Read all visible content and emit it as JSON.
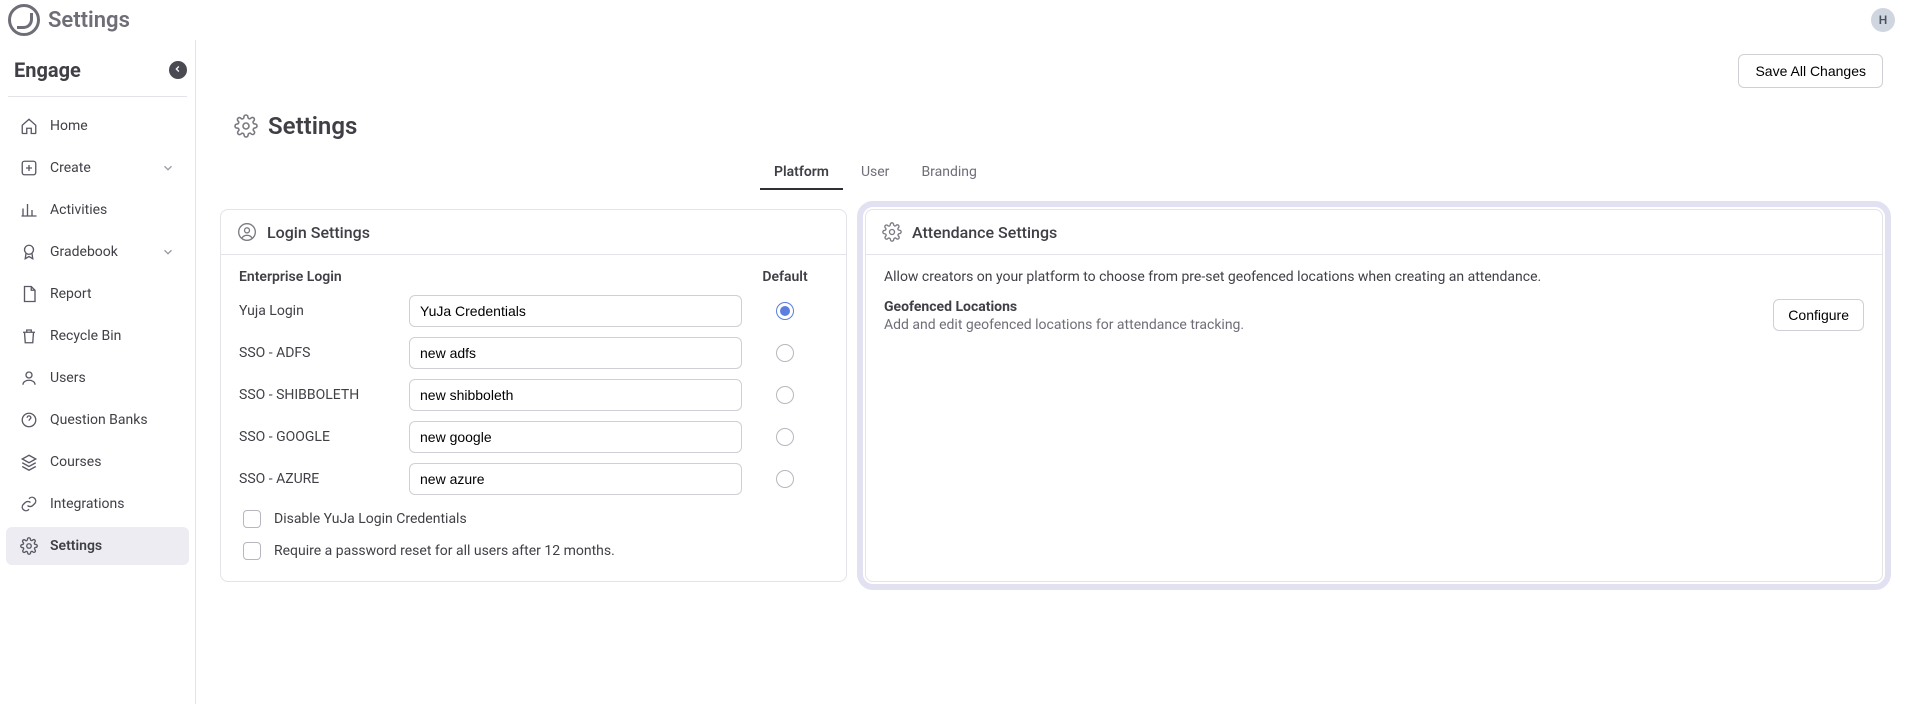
{
  "topbar": {
    "title": "Settings",
    "avatar_initial": "H"
  },
  "sidebar": {
    "product": "Engage",
    "items": [
      {
        "name": "home",
        "label": "Home",
        "icon": "home-icon",
        "expandable": false
      },
      {
        "name": "create",
        "label": "Create",
        "icon": "plus-box-icon",
        "expandable": true
      },
      {
        "name": "activities",
        "label": "Activities",
        "icon": "bar-chart-icon",
        "expandable": false
      },
      {
        "name": "gradebook",
        "label": "Gradebook",
        "icon": "star-badge-icon",
        "expandable": true
      },
      {
        "name": "report",
        "label": "Report",
        "icon": "document-icon",
        "expandable": false
      },
      {
        "name": "recycle-bin",
        "label": "Recycle Bin",
        "icon": "trash-icon",
        "expandable": false
      },
      {
        "name": "users",
        "label": "Users",
        "icon": "user-icon",
        "expandable": false
      },
      {
        "name": "question-banks",
        "label": "Question Banks",
        "icon": "question-icon",
        "expandable": false
      },
      {
        "name": "courses",
        "label": "Courses",
        "icon": "stack-icon",
        "expandable": false
      },
      {
        "name": "integrations",
        "label": "Integrations",
        "icon": "link-icon",
        "expandable": false
      },
      {
        "name": "settings",
        "label": "Settings",
        "icon": "gear-icon",
        "expandable": false
      }
    ],
    "active": "settings"
  },
  "main": {
    "save_button": "Save All Changes",
    "panel_title": "Settings",
    "tabs": [
      {
        "name": "platform",
        "label": "Platform"
      },
      {
        "name": "user",
        "label": "User"
      },
      {
        "name": "branding",
        "label": "Branding"
      }
    ],
    "active_tab": "platform"
  },
  "login_card": {
    "title": "Login Settings",
    "col_provider": "Enterprise Login",
    "col_default": "Default",
    "rows": [
      {
        "name": "yuja",
        "label": "Yuja Login",
        "value": "YuJa Credentials",
        "default": true
      },
      {
        "name": "adfs",
        "label": "SSO - ADFS",
        "value": "new adfs",
        "default": false
      },
      {
        "name": "shibboleth",
        "label": "SSO - SHIBBOLETH",
        "value": "new shibboleth",
        "default": false
      },
      {
        "name": "google",
        "label": "SSO - GOOGLE",
        "value": "new google",
        "default": false
      },
      {
        "name": "azure",
        "label": "SSO - AZURE",
        "value": "new azure",
        "default": false
      }
    ],
    "checkboxes": [
      {
        "name": "disable-creds",
        "label": "Disable YuJa Login Credentials",
        "checked": false
      },
      {
        "name": "require-reset",
        "label": "Require a password reset for all users after 12 months.",
        "checked": false
      }
    ]
  },
  "attendance_card": {
    "title": "Attendance Settings",
    "desc": "Allow creators on your platform to choose from pre-set geofenced locations when creating an attendance.",
    "section_title": "Geofenced Locations",
    "section_sub": "Add and edit geofenced locations for attendance tracking.",
    "configure_btn": "Configure"
  }
}
